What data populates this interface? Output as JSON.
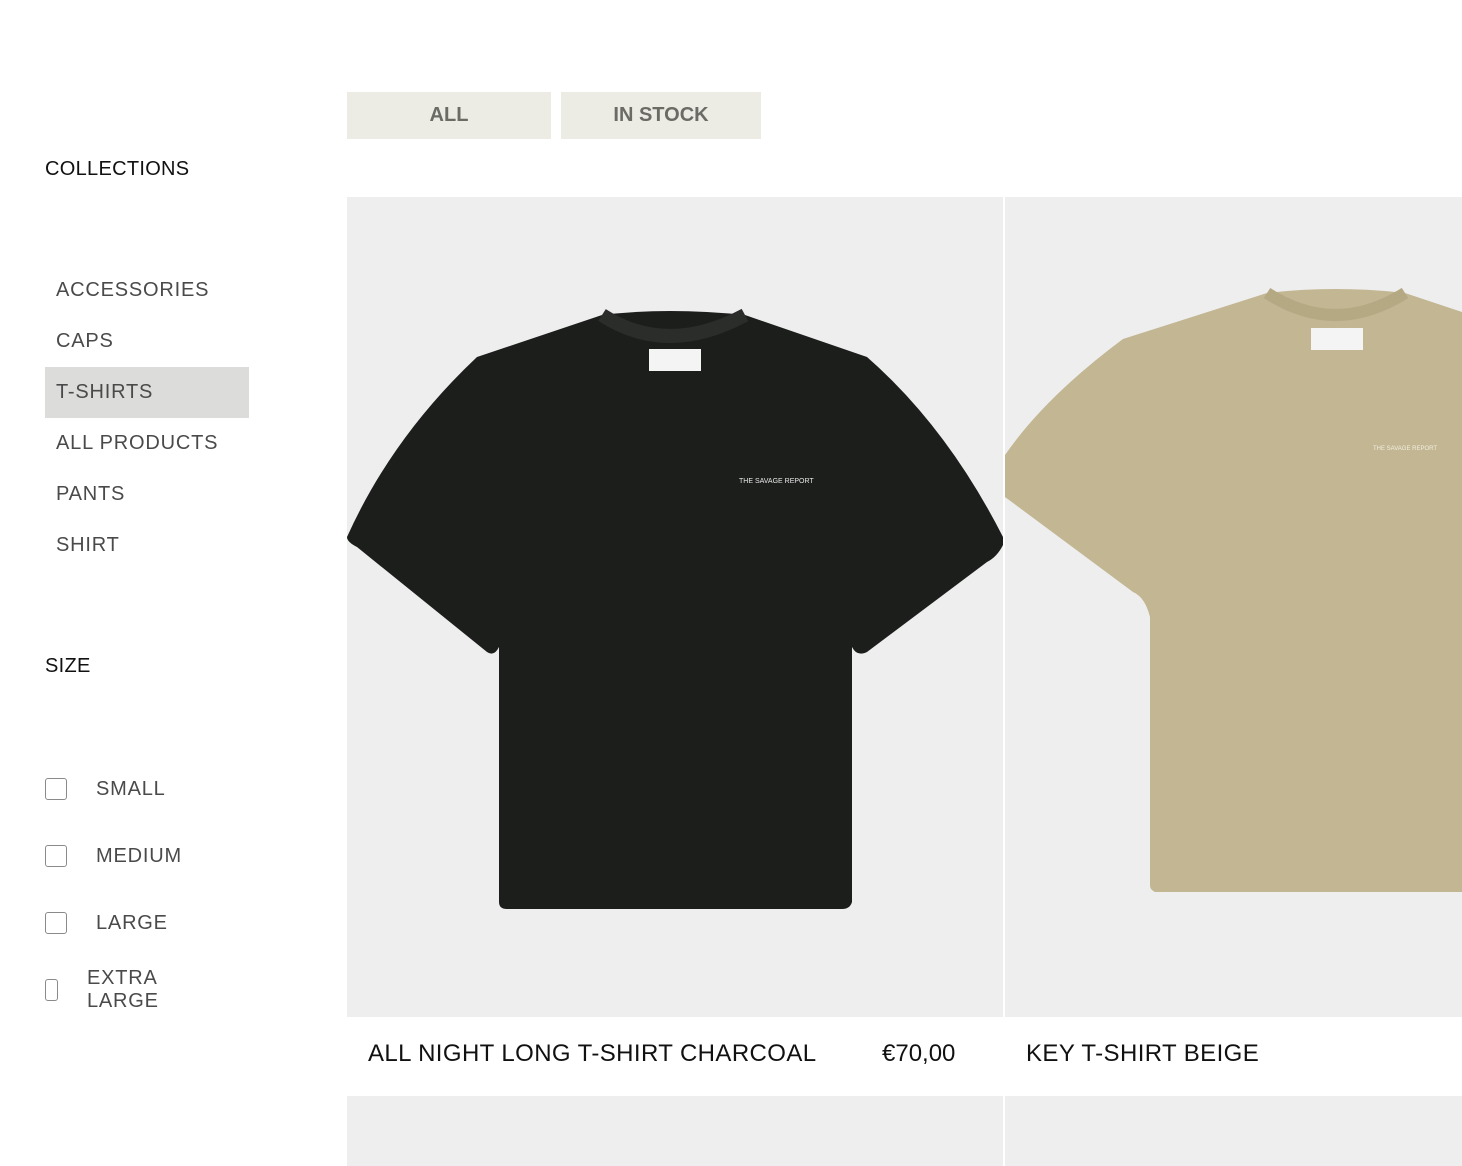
{
  "filters": {
    "all_label": "ALL",
    "in_stock_label": "IN STOCK"
  },
  "sidebar": {
    "collections_heading": "COLLECTIONS",
    "collections": [
      {
        "label": "ACCESSORIES",
        "active": false
      },
      {
        "label": "CAPS",
        "active": false
      },
      {
        "label": "T-SHIRTS",
        "active": true
      },
      {
        "label": "ALL PRODUCTS",
        "active": false
      },
      {
        "label": "PANTS",
        "active": false
      },
      {
        "label": "SHIRT",
        "active": false
      }
    ],
    "size_heading": "SIZE",
    "sizes": [
      {
        "label": "SMALL",
        "checked": false
      },
      {
        "label": "MEDIUM",
        "checked": false
      },
      {
        "label": "LARGE",
        "checked": false
      },
      {
        "label": "EXTRA LARGE",
        "checked": false
      }
    ]
  },
  "products": [
    {
      "name": "ALL NIGHT LONG T-SHIRT CHARCOAL",
      "price": "€70,00",
      "color": "#1c1e1c",
      "print_text": "THE SAVAGE REPORT"
    },
    {
      "name": "KEY T-SHIRT BEIGE",
      "price": "",
      "color": "#c2b693",
      "print_text": "THE SAVAGE REPORT"
    }
  ],
  "colors": {
    "active_collection_bg": "#dcdcda",
    "filter_bg": "#ecebe4",
    "card_bg": "#eeeeee"
  }
}
